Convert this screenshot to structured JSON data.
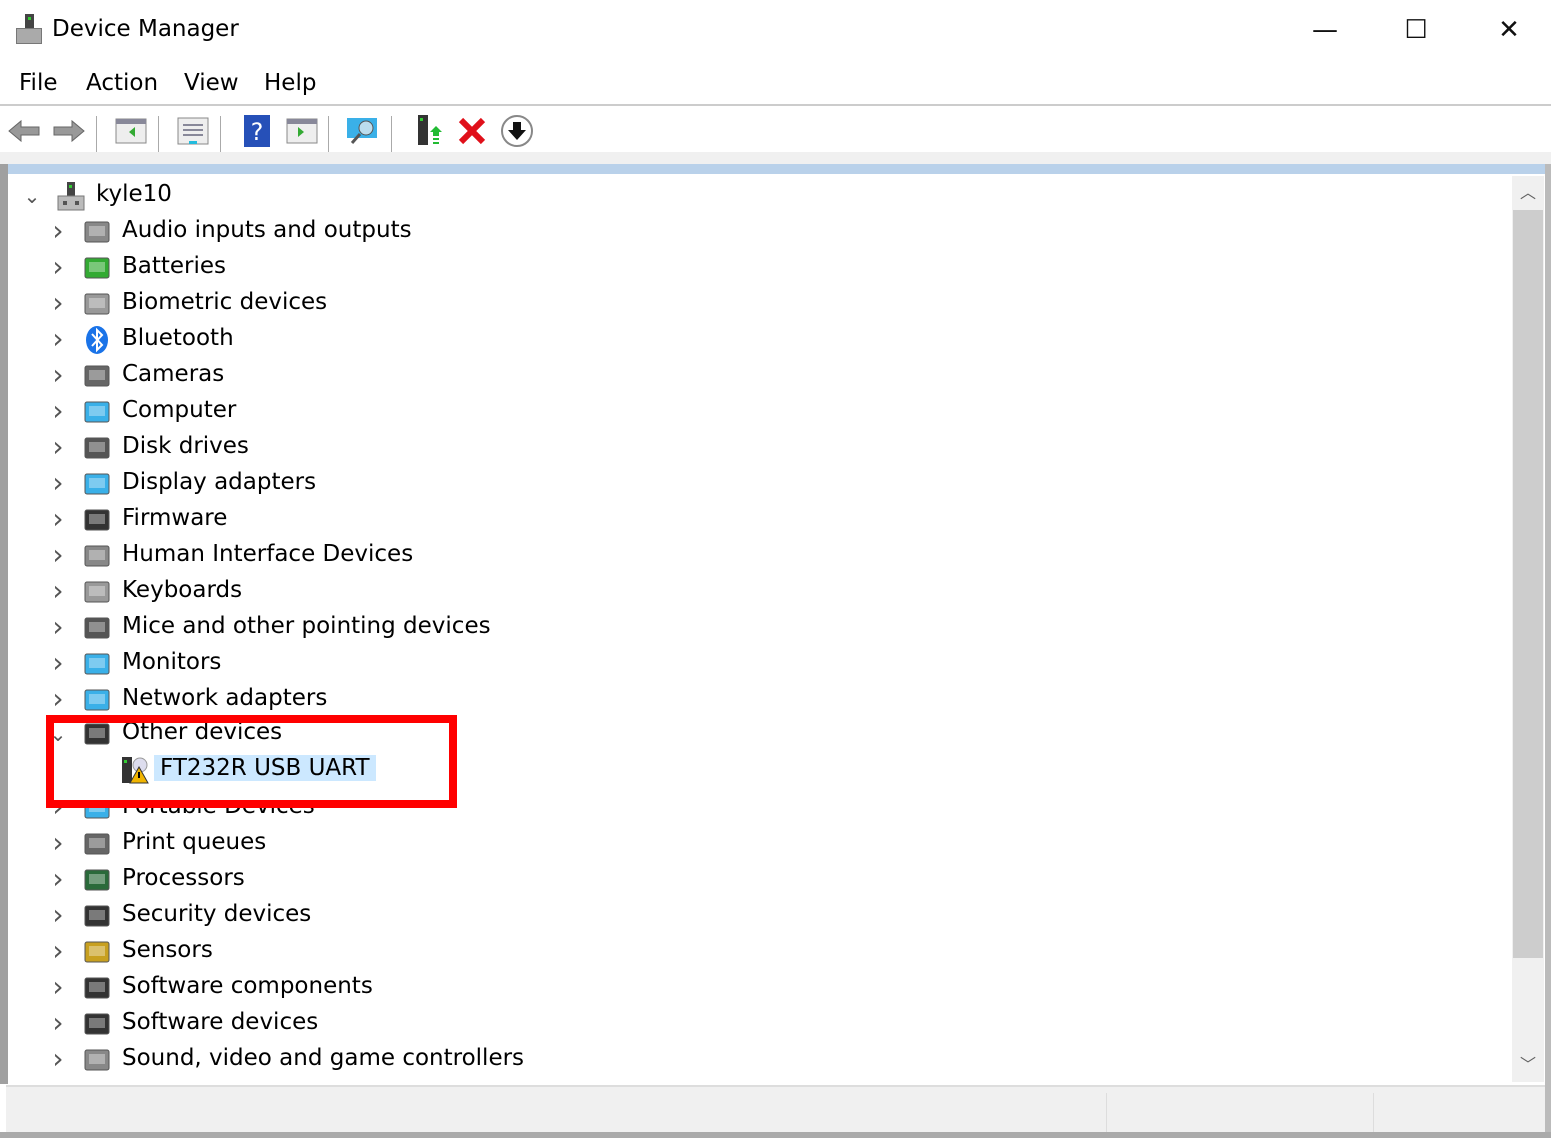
{
  "window": {
    "title": "Device Manager",
    "minimize": "—",
    "maximize": "☐",
    "close": "✕"
  },
  "menu": [
    "File",
    "Action",
    "View",
    "Help"
  ],
  "toolbar": [
    "back",
    "forward",
    "show-hide-console-tree",
    "properties",
    "help",
    "show-hide-action-pane",
    "scan-hardware-changes",
    "update-driver",
    "uninstall-device",
    "disable-device"
  ],
  "tree": {
    "root": "kyle10",
    "items": [
      {
        "label": "Audio inputs and outputs",
        "icon": "speaker-icon",
        "expanded": false
      },
      {
        "label": "Batteries",
        "icon": "battery-icon",
        "expanded": false
      },
      {
        "label": "Biometric devices",
        "icon": "fingerprint-icon",
        "expanded": false
      },
      {
        "label": "Bluetooth",
        "icon": "bluetooth-icon",
        "expanded": false
      },
      {
        "label": "Cameras",
        "icon": "webcam-icon",
        "expanded": false
      },
      {
        "label": "Computer",
        "icon": "monitor-icon",
        "expanded": false
      },
      {
        "label": "Disk drives",
        "icon": "disk-drive-icon",
        "expanded": false
      },
      {
        "label": "Display adapters",
        "icon": "display-adapter-icon",
        "expanded": false
      },
      {
        "label": "Firmware",
        "icon": "chip-icon",
        "expanded": false
      },
      {
        "label": "Human Interface Devices",
        "icon": "hid-icon",
        "expanded": false
      },
      {
        "label": "Keyboards",
        "icon": "keyboard-icon",
        "expanded": false
      },
      {
        "label": "Mice and other pointing devices",
        "icon": "mouse-icon",
        "expanded": false
      },
      {
        "label": "Monitors",
        "icon": "monitor-icon",
        "expanded": false
      },
      {
        "label": "Network adapters",
        "icon": "network-icon",
        "expanded": false
      },
      {
        "label": "Other devices",
        "icon": "unknown-device-icon",
        "expanded": true,
        "children": [
          {
            "label": "FT232R USB UART",
            "icon": "warning-device-icon",
            "selected": true
          }
        ]
      },
      {
        "label": "Portable Devices",
        "icon": "portable-device-icon",
        "expanded": false
      },
      {
        "label": "Print queues",
        "icon": "printer-icon",
        "expanded": false
      },
      {
        "label": "Processors",
        "icon": "processor-icon",
        "expanded": false
      },
      {
        "label": "Security devices",
        "icon": "security-key-icon",
        "expanded": false
      },
      {
        "label": "Sensors",
        "icon": "sensor-icon",
        "expanded": false
      },
      {
        "label": "Software components",
        "icon": "software-component-icon",
        "expanded": false
      },
      {
        "label": "Software devices",
        "icon": "software-device-icon",
        "expanded": false
      },
      {
        "label": "Sound, video and game controllers",
        "icon": "speaker-icon",
        "expanded": false
      }
    ]
  },
  "highlight_color": "#ff0000",
  "selection_color": "#cce8ff"
}
